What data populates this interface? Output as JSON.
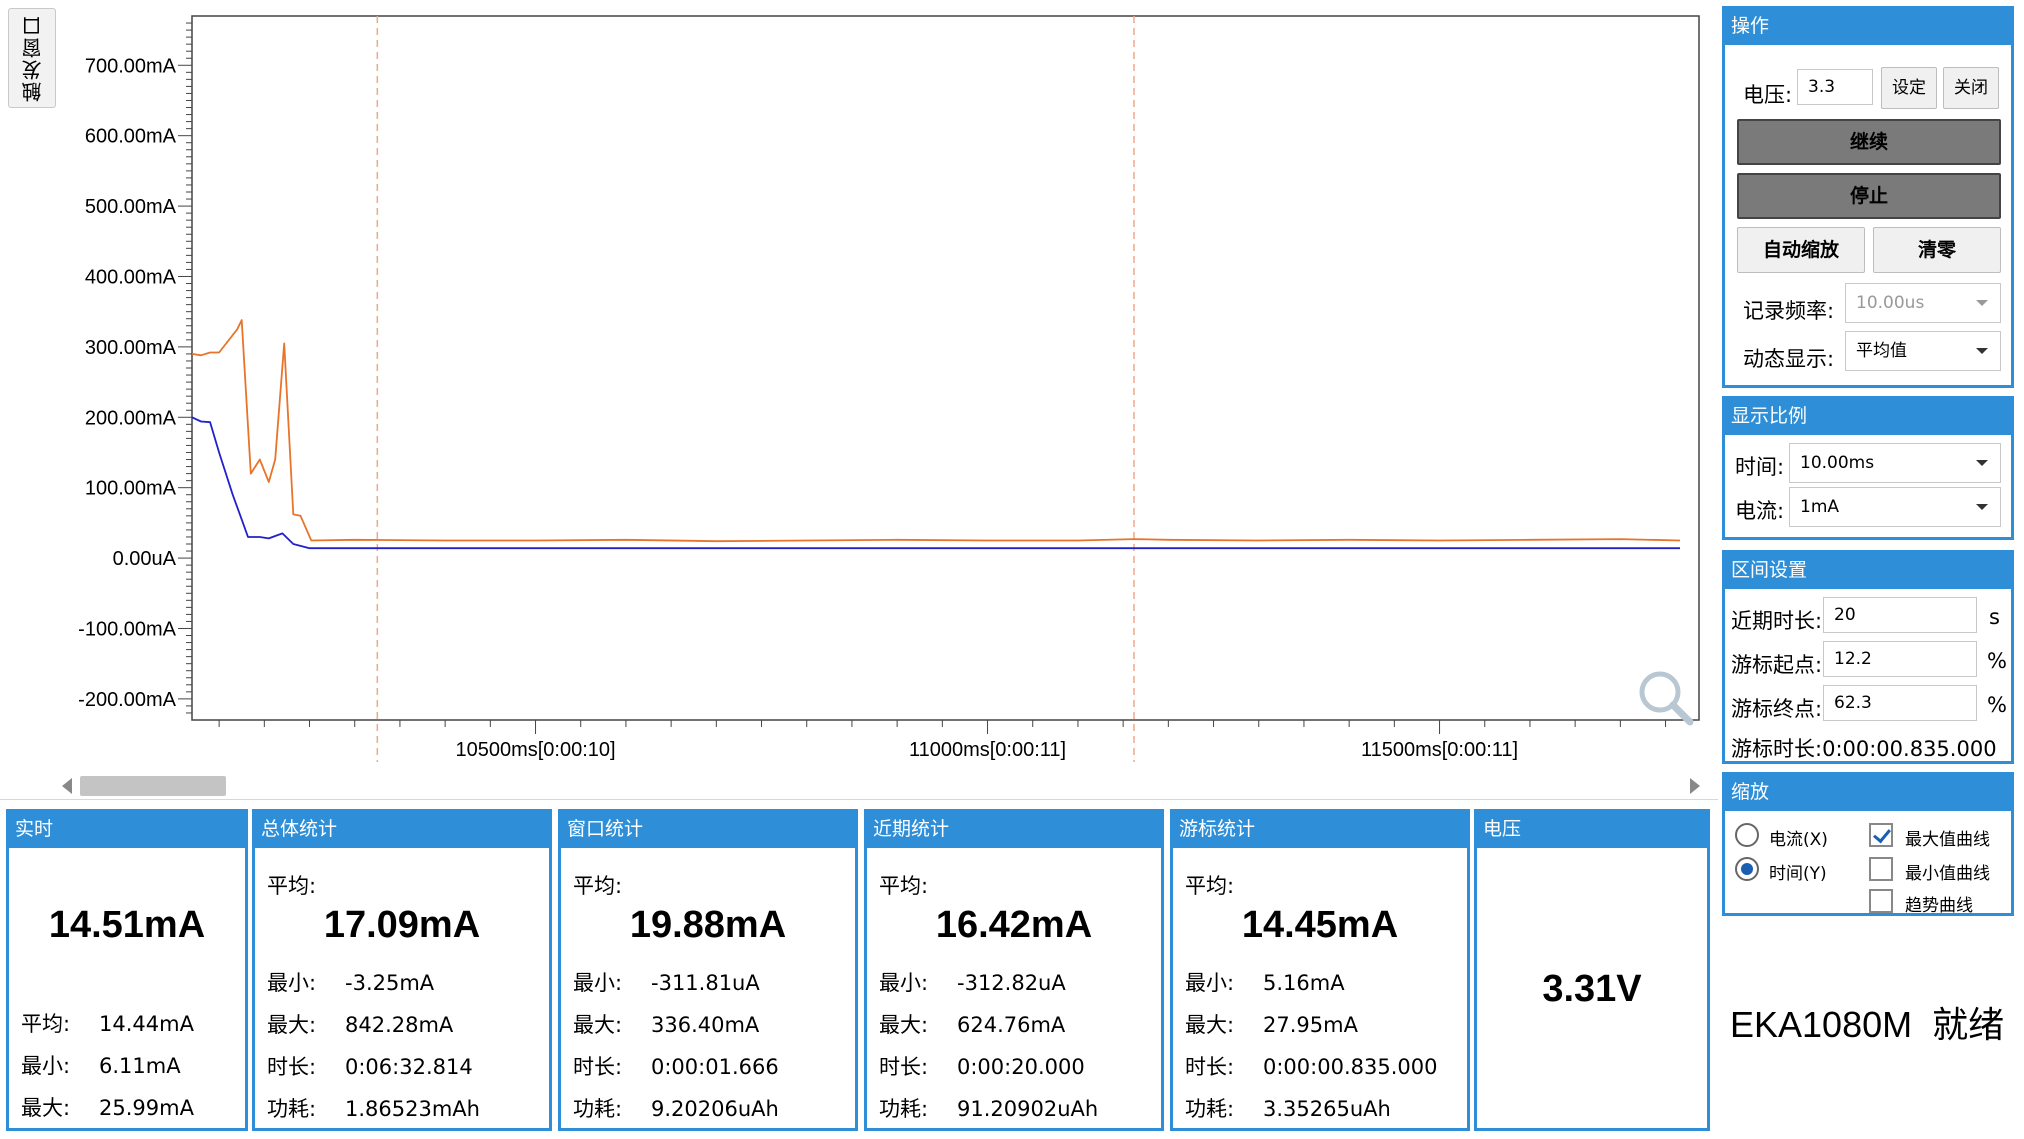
{
  "trigger_tab": "触发窗口",
  "chart_data": {
    "type": "line",
    "y_ticks": [
      {
        "label": "700.00mA",
        "value": 700
      },
      {
        "label": "600.00mA",
        "value": 600
      },
      {
        "label": "500.00mA",
        "value": 500
      },
      {
        "label": "400.00mA",
        "value": 400
      },
      {
        "label": "300.00mA",
        "value": 300
      },
      {
        "label": "200.00mA",
        "value": 200
      },
      {
        "label": "100.00mA",
        "value": 100
      },
      {
        "label": "0.00uA",
        "value": 0
      },
      {
        "label": "-100.00mA",
        "value": -100
      },
      {
        "label": "-200.00mA",
        "value": -200
      }
    ],
    "ylim": [
      -230,
      770
    ],
    "xlim": [
      10120,
      11787
    ],
    "x_ticks": [
      {
        "label": "10500ms[0:00:10]",
        "value": 10500
      },
      {
        "label": "11000ms[0:00:11]",
        "value": 11000
      },
      {
        "label": "11500ms[0:00:11]",
        "value": 11500
      }
    ],
    "cursors_ms": [
      10325,
      11162
    ],
    "series": [
      {
        "color": "#e8742a",
        "points": [
          [
            10120,
            290
          ],
          [
            10130,
            288
          ],
          [
            10140,
            292
          ],
          [
            10150,
            292
          ],
          [
            10170,
            325
          ],
          [
            10175,
            338
          ],
          [
            10185,
            120
          ],
          [
            10195,
            140
          ],
          [
            10205,
            108
          ],
          [
            10212,
            140
          ],
          [
            10222,
            305
          ],
          [
            10232,
            62
          ],
          [
            10240,
            60
          ],
          [
            10252,
            25
          ],
          [
            10300,
            26
          ],
          [
            10400,
            25
          ],
          [
            10500,
            25
          ],
          [
            10600,
            26
          ],
          [
            10700,
            24
          ],
          [
            10800,
            25
          ],
          [
            10900,
            26
          ],
          [
            11000,
            25
          ],
          [
            11100,
            25
          ],
          [
            11162,
            27
          ],
          [
            11200,
            26
          ],
          [
            11300,
            25
          ],
          [
            11400,
            26
          ],
          [
            11500,
            25
          ],
          [
            11600,
            26
          ],
          [
            11700,
            27
          ],
          [
            11766,
            25
          ]
        ]
      },
      {
        "color": "#2121c9",
        "points": [
          [
            10120,
            200
          ],
          [
            10130,
            194
          ],
          [
            10140,
            193
          ],
          [
            10150,
            150
          ],
          [
            10165,
            90
          ],
          [
            10175,
            55
          ],
          [
            10182,
            30
          ],
          [
            10195,
            30
          ],
          [
            10205,
            28
          ],
          [
            10220,
            35
          ],
          [
            10232,
            20
          ],
          [
            10250,
            14
          ],
          [
            10300,
            14
          ],
          [
            10500,
            14
          ],
          [
            10800,
            14
          ],
          [
            11000,
            14
          ],
          [
            11300,
            14
          ],
          [
            11600,
            14
          ],
          [
            11766,
            14
          ]
        ]
      }
    ]
  },
  "stats": {
    "realtime": {
      "title": "实时",
      "value": "14.51mA",
      "avg_k": "平均:",
      "avg": "14.44mA",
      "min_k": "最小:",
      "min": "6.11mA",
      "max_k": "最大:",
      "max": "25.99mA"
    },
    "total": {
      "title": "总体统计",
      "avg_k": "平均:",
      "value": "17.09mA",
      "min_k": "最小:",
      "min": "-3.25mA",
      "max_k": "最大:",
      "max": "842.28mA",
      "dur_k": "时长:",
      "dur": "0:06:32.814",
      "pow_k": "功耗:",
      "pow": "1.86523mAh"
    },
    "window": {
      "title": "窗口统计",
      "avg_k": "平均:",
      "value": "19.88mA",
      "min_k": "最小:",
      "min": "-311.81uA",
      "max_k": "最大:",
      "max": "336.40mA",
      "dur_k": "时长:",
      "dur": "0:00:01.666",
      "pow_k": "功耗:",
      "pow": "9.20206uAh"
    },
    "recent": {
      "title": "近期统计",
      "avg_k": "平均:",
      "value": "16.42mA",
      "min_k": "最小:",
      "min": "-312.82uA",
      "max_k": "最大:",
      "max": "624.76mA",
      "dur_k": "时长:",
      "dur": "0:00:20.000",
      "pow_k": "功耗:",
      "pow": "91.20902uAh"
    },
    "cursor": {
      "title": "游标统计",
      "avg_k": "平均:",
      "value": "14.45mA",
      "min_k": "最小:",
      "min": "5.16mA",
      "max_k": "最大:",
      "max": "27.95mA",
      "dur_k": "时长:",
      "dur": "0:00:00.835.000",
      "pow_k": "功耗:",
      "pow": "3.35265uAh"
    },
    "voltage": {
      "title": "电压",
      "value": "3.31V"
    }
  },
  "ops": {
    "title": "操作",
    "voltage_label": "电压:",
    "voltage_value": "3.3",
    "set_btn": "设定",
    "close_btn": "关闭",
    "continue_btn": "继续",
    "stop_btn": "停止",
    "autoscale_btn": "自动缩放",
    "clear_btn": "清零",
    "rate_label": "记录频率:",
    "rate_value": "10.00us",
    "dyn_label": "动态显示:",
    "dyn_value": "平均值"
  },
  "scale": {
    "title": "显示比例",
    "time_label": "时间:",
    "time_value": "10.00ms",
    "current_label": "电流:",
    "current_value": "1mA"
  },
  "interval": {
    "title": "区间设置",
    "recent_label": "近期时长:",
    "recent_value": "20",
    "recent_unit": "s",
    "start_label": "游标起点:",
    "start_value": "12.2",
    "start_unit": "%",
    "end_label": "游标终点:",
    "end_value": "62.3",
    "end_unit": "%",
    "dur_label": "游标时长:",
    "dur_value": "0:00:00.835.000"
  },
  "zoom": {
    "title": "缩放",
    "current_x": "电流(X)",
    "time_y": "时间(Y)",
    "selected": "time_y",
    "max_curve": "最大值曲线",
    "min_curve": "最小值曲线",
    "trend_curve": "趋势曲线",
    "max_checked": true,
    "min_checked": false,
    "trend_checked": false
  },
  "status": {
    "device": "EKA1080M",
    "state": "就绪"
  }
}
